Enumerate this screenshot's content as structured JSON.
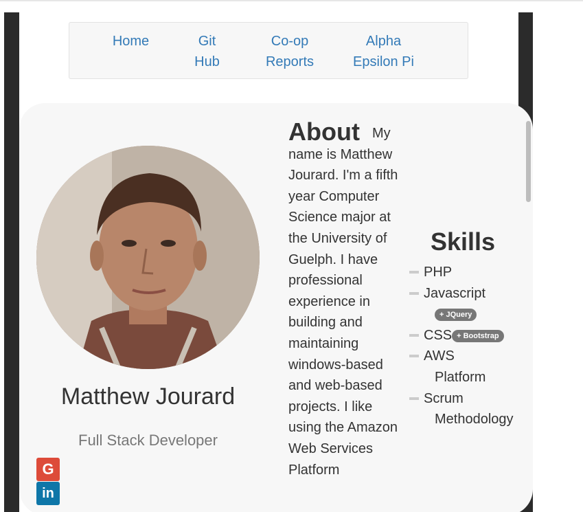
{
  "nav": {
    "items": [
      {
        "label": "Home"
      },
      {
        "label": "Git\nHub"
      },
      {
        "label": "Co-op\nReports"
      },
      {
        "label": "Alpha\nEpsilon Pi"
      }
    ]
  },
  "profile": {
    "name": "Matthew Jourard",
    "subtitle": "Full Stack Developer",
    "social": [
      {
        "icon": "google-icon",
        "glyph": "G",
        "color": "#dd4b39"
      },
      {
        "icon": "linkedin-icon",
        "glyph": "in",
        "color": "#0e76a8"
      }
    ]
  },
  "about": {
    "heading": "About",
    "text": "My name is Matthew Jourard. I'm a fifth year Computer Science major at the University of Guelph. I have professional experience in building and maintaining windows-based and web-based projects. I like using the Amazon Web Services Platform"
  },
  "skills": {
    "heading": "Skills",
    "items": [
      {
        "label": "PHP"
      },
      {
        "label": "Javascript",
        "badge": "+ JQuery"
      },
      {
        "label": "CSS",
        "badge": "+ Bootstrap"
      },
      {
        "label": "AWS",
        "label_cont": "Platform"
      },
      {
        "label": "Scrum",
        "label_cont": "Methodology"
      }
    ]
  },
  "colors": {
    "link": "#337ab7",
    "text": "#333333",
    "muted": "#777777",
    "badge": "#777777"
  }
}
